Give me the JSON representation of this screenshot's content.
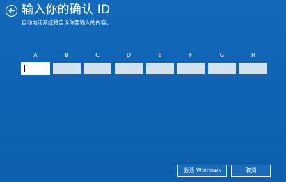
{
  "header": {
    "back_icon": "back-arrow-circle-icon",
    "title": "输入你的确认 ID",
    "subtitle": "自动电话系统将告诉你要输入的内容。"
  },
  "confirmation_id": {
    "columns": [
      {
        "label": "A",
        "value": ""
      },
      {
        "label": "B",
        "value": ""
      },
      {
        "label": "C",
        "value": ""
      },
      {
        "label": "D",
        "value": ""
      },
      {
        "label": "E",
        "value": ""
      },
      {
        "label": "F",
        "value": ""
      },
      {
        "label": "G",
        "value": ""
      },
      {
        "label": "H",
        "value": ""
      }
    ],
    "active_field": "A"
  },
  "actions": {
    "activate_label": "激活 Windows",
    "cancel_label": "取消"
  },
  "colors": {
    "background": "#0f63b4",
    "text": "#ffffff",
    "field_fill": "#d4e1ef",
    "active_field_fill": "#ffffff"
  }
}
